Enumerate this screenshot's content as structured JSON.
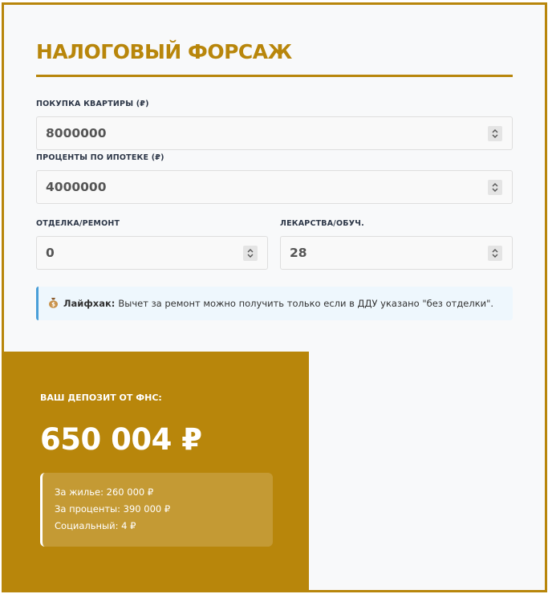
{
  "header": {
    "title": "НАЛОГОВЫЙ ФОРСАЖ"
  },
  "form": {
    "apartment": {
      "label": "ПОКУПКА КВАРТИРЫ (₽)",
      "value": "8000000"
    },
    "interest": {
      "label": "ПРОЦЕНТЫ ПО ИПОТЕКЕ (₽)",
      "value": "4000000"
    },
    "renovation": {
      "label": "ОТДЕЛКА/РЕМОНТ",
      "value": "0"
    },
    "medicine": {
      "label": "ЛЕКАРСТВА/ОБУЧ.",
      "value": "28"
    }
  },
  "tip": {
    "icon": "money-bag-icon",
    "title": "Лайфхак:",
    "text": "Вычет за ремонт можно получить только если в ДДУ указано \"без отделки\"."
  },
  "result": {
    "label": "ВАШ ДЕПОЗИТ ОТ ФНС:",
    "value": "650 004 ₽",
    "breakdown": [
      "За жилье: 260 000 ₽",
      "За проценты: 390 000 ₽",
      "Социальный: 4 ₽"
    ]
  },
  "colors": {
    "accent": "#b8860b",
    "tip_border": "#4a9fd8",
    "tip_background": "#eef7fd"
  }
}
